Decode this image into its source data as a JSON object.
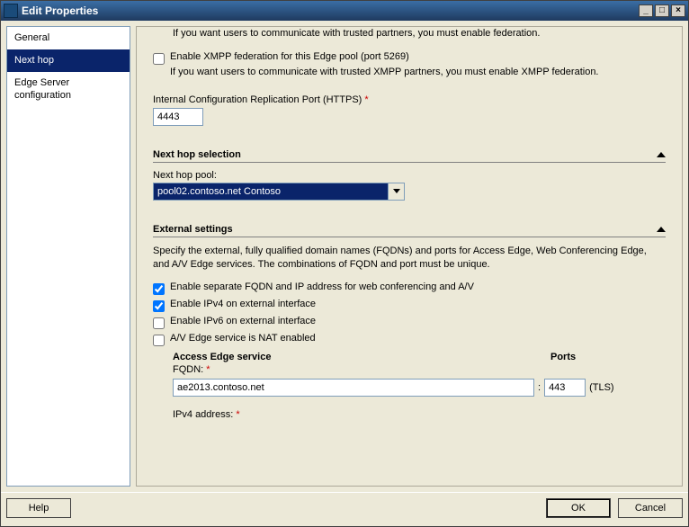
{
  "titlebar": {
    "title": "Edit Properties"
  },
  "sidebar": {
    "items": [
      {
        "label": "General"
      },
      {
        "label": "Next hop"
      },
      {
        "label": "Edge Server configuration"
      }
    ]
  },
  "main": {
    "federation_tail_text": "If you want users to communicate with trusted partners, you must enable federation.",
    "xmpp": {
      "label": "Enable XMPP federation for this Edge pool (port 5269)",
      "hint": "If you want users to communicate with trusted XMPP partners, you must enable XMPP federation.",
      "checked": false
    },
    "internal_port": {
      "label": "Internal Configuration Replication Port (HTTPS)",
      "value": "4443"
    },
    "next_hop": {
      "header": "Next hop selection",
      "pool_label": "Next hop pool:",
      "pool_value": "pool02.contoso.net   Contoso"
    },
    "external": {
      "header": "External settings",
      "desc": "Specify the external, fully qualified domain names (FQDNs) and ports for Access Edge, Web Conferencing Edge, and A/V Edge services. The combinations of FQDN and port must be unique.",
      "cb1": "Enable separate FQDN and IP address for web conferencing and A/V",
      "cb2": "Enable IPv4 on external interface",
      "cb3": "Enable IPv6 on external interface",
      "cb4": "A/V Edge service is NAT enabled",
      "access_edge_header": "Access Edge service",
      "ports_header": "Ports",
      "fqdn_label": "FQDN:",
      "fqdn_value": "ae2013.contoso.net",
      "port_value": "443",
      "tls_label": "(TLS)",
      "ipv4_label": "IPv4 address:"
    }
  },
  "footer": {
    "help": "Help",
    "ok": "OK",
    "cancel": "Cancel"
  }
}
